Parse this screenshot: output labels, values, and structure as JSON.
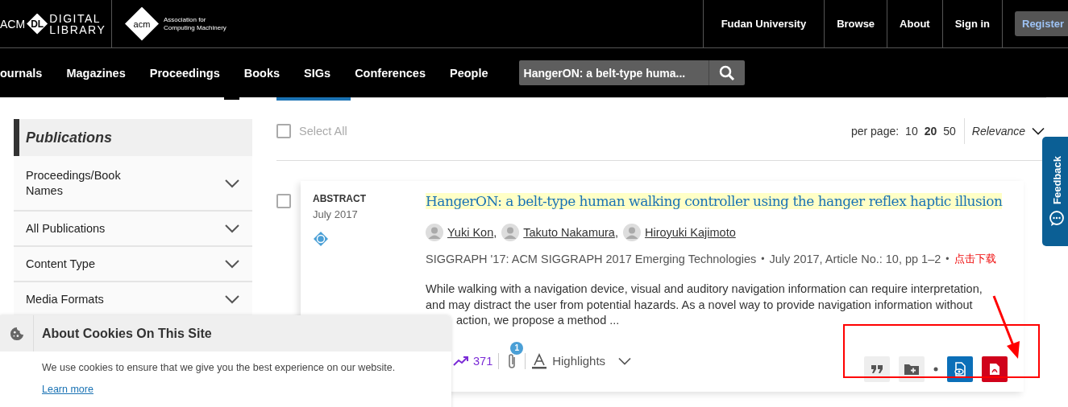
{
  "header": {
    "logo": {
      "prefix": "ACM",
      "mark": "DL",
      "line1": "DIGITAL",
      "line2": "LIBRARY"
    },
    "org_logo": {
      "mark": "acm",
      "line1": "Association for",
      "line2": "Computing Machinery"
    },
    "links": [
      "Fudan University",
      "Browse",
      "About",
      "Sign in"
    ],
    "register": "Register"
  },
  "nav": {
    "items": [
      "ournals",
      "Magazines",
      "Proceedings",
      "Books",
      "SIGs",
      "Conferences",
      "People"
    ],
    "search": {
      "value": "HangerON: a belt-type huma..."
    }
  },
  "sidebar": {
    "title": "Publications",
    "facets": [
      {
        "label": "Proceedings/Book Names",
        "expanded": false
      },
      {
        "label": "All Publications",
        "expanded": false
      },
      {
        "label": "Content Type",
        "expanded": false
      },
      {
        "label": "Media Formats",
        "expanded": false
      }
    ]
  },
  "toolbar": {
    "select_all": {
      "label": "Select All",
      "checked": false
    },
    "per_page": {
      "label": "per page:",
      "options": [
        {
          "label": "10",
          "selected": false
        },
        {
          "label": "20",
          "selected": true
        },
        {
          "label": "50",
          "selected": false
        }
      ]
    },
    "sort": "Relevance"
  },
  "results": [
    {
      "checked": false,
      "type": "ABSTRACT",
      "date": "July 2017",
      "title": "HangerON: a belt-type human walking controller using the hanger reflex haptic illusion",
      "authors": [
        "Yuki Kon",
        "Takuto Nakamura",
        "Hiroyuki Kajimoto"
      ],
      "author_separator": ",",
      "separator": "•",
      "venue": "SIGGRAPH '17: ACM SIGGRAPH 2017 Emerging Technologies",
      "details": "July 2017, Article No.: 10, pp 1–2",
      "download_link": "点击下载",
      "abstract_lines": [
        "While walking with a navigation device, visual and auditory navigation information can require interpretation,",
        "and may distract the user from potential hazards. As a novel way to provide navigation information without",
        "action, we propose a method ..."
      ],
      "metrics": {
        "downloads": "371",
        "attachments": "1",
        "highlights": "Highlights"
      }
    }
  ],
  "feedback": "Feedback",
  "cookie_banner": {
    "title": "About Cookies On This Site",
    "text": "We use cookies to ensure that we give you the best experience on our website.",
    "link": "Learn more"
  }
}
